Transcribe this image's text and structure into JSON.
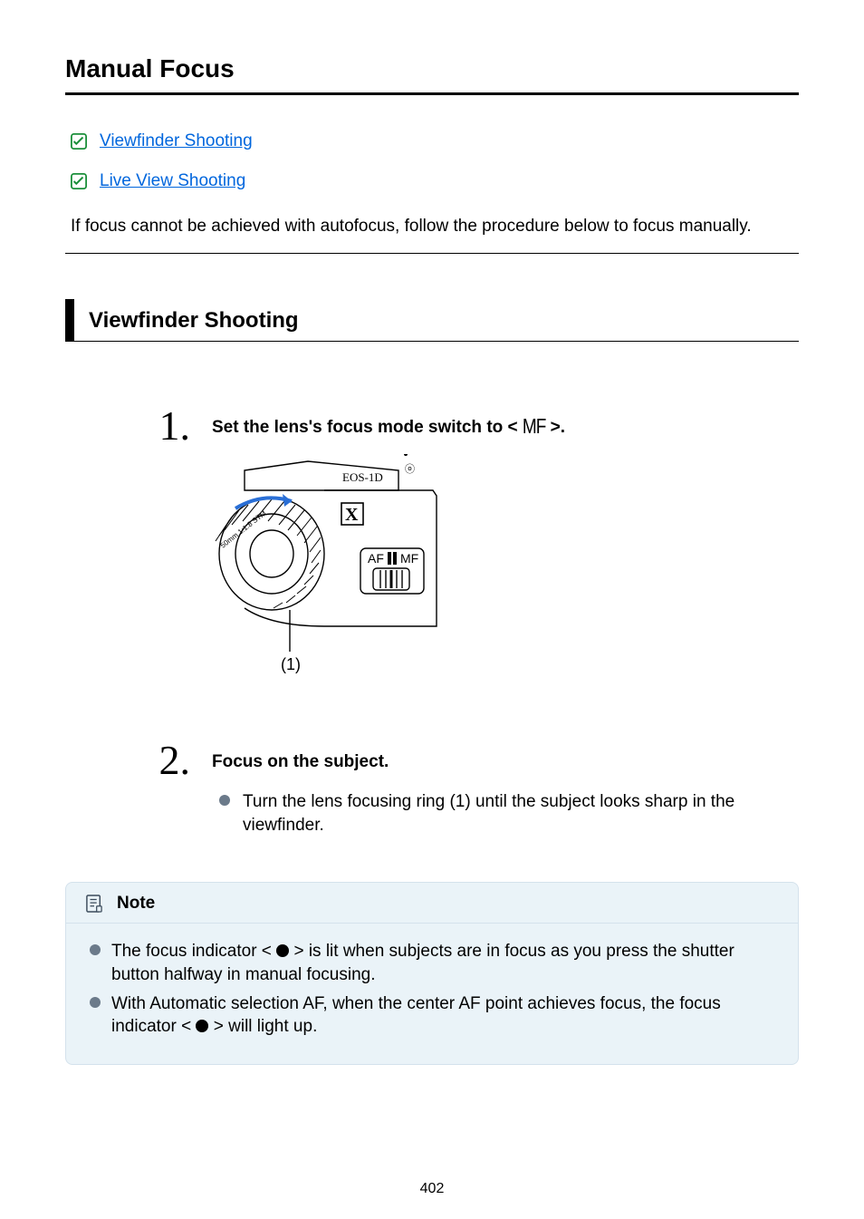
{
  "title": "Manual Focus",
  "links": [
    {
      "label": "Viewfinder Shooting"
    },
    {
      "label": "Live View Shooting"
    }
  ],
  "intro": "If focus cannot be achieved with autofocus, follow the procedure below to focus manually.",
  "section_heading": "Viewfinder Shooting",
  "steps": {
    "s1_num": "1",
    "s1_title_pre": "Set the lens's focus mode switch to < ",
    "s1_title_glyph": "MF",
    "s1_title_post": " >.",
    "s2_num": "2",
    "s2_title": "Focus on the subject.",
    "s2_bullet": "Turn the lens focusing ring (1) until the subject looks sharp in the viewfinder."
  },
  "note": {
    "title": "Note",
    "items": [
      {
        "pre": "The focus indicator < ",
        "post": " > is lit when subjects are in focus as you press the shutter button halfway in manual focusing."
      },
      {
        "pre": "With Automatic selection AF, when the center AF point achieves focus, the focus indicator < ",
        "post": " > will light up."
      }
    ]
  },
  "page_number": "402"
}
